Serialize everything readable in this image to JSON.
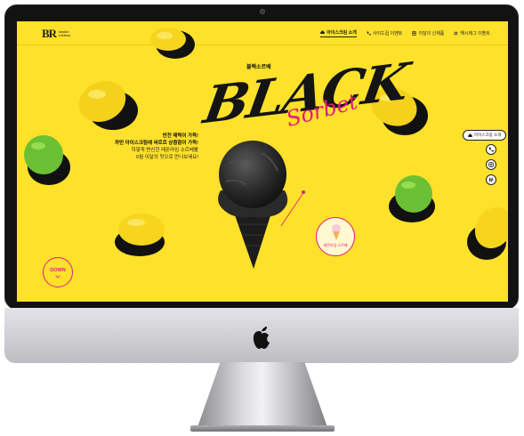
{
  "brand": {
    "logo_mark": "BR",
    "logo_text": "baskin robbins"
  },
  "nav": {
    "items": [
      {
        "label": "아이스크림 소개",
        "icon": "cloud-icon"
      },
      {
        "label": "사이드컵 이벤트",
        "icon": "phone-icon"
      },
      {
        "label": "이달의 신제품",
        "icon": "doc-icon"
      },
      {
        "label": "해시태그 이벤트",
        "icon": "hash-icon"
      }
    ]
  },
  "hero": {
    "subtitle": "블랙소르베",
    "title_main": "BLACK",
    "title_script": "Sorbet",
    "desc": {
      "lines_bold": [
        "반전 매력이 가득!",
        "까만 아이스크림에 싸르르 상큼함이 가득!"
      ],
      "lines": [
        "하얗게 변신한 레몬라임 소르베를",
        "6월 이달의 맛으로 만나보세요!"
      ]
    },
    "badge_label": "레몬라임 소르베"
  },
  "scroll": {
    "down_label": "DOWN"
  },
  "side": {
    "pill_label": "아이스크림 소개",
    "buttons": [
      "phone-icon",
      "instagram-icon",
      "hash-icon"
    ]
  },
  "colors": {
    "background": "#fde12a",
    "accent": "#e6197e",
    "text": "#111111"
  }
}
